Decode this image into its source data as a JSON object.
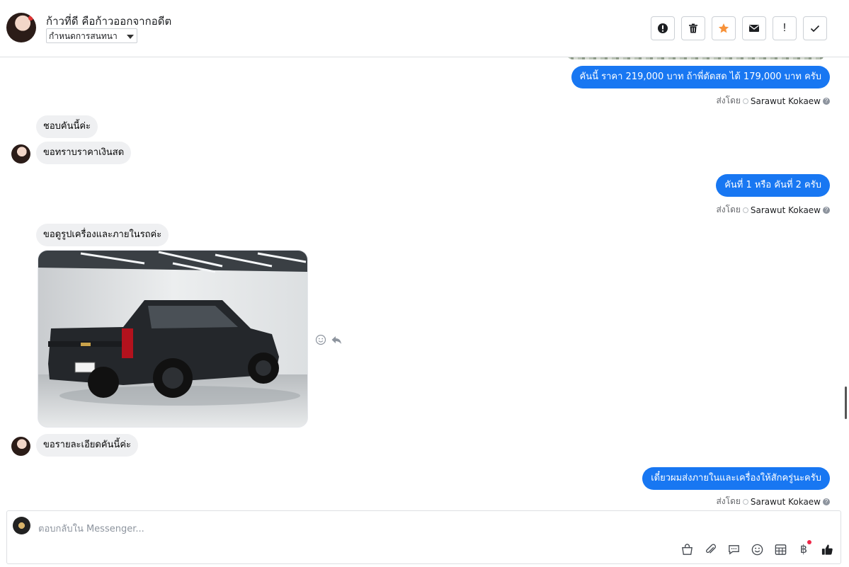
{
  "header": {
    "title": "ก้าวที่ดี คือก้าวออกจากอดีต",
    "assign_label": "กำหนดการสนทนา",
    "actions": [
      {
        "name": "spam-alert-button",
        "icon": "alert-circle-icon"
      },
      {
        "name": "delete-button",
        "icon": "trash-icon"
      },
      {
        "name": "star-button",
        "icon": "star-icon",
        "color": "#f7923a"
      },
      {
        "name": "mark-unread-button",
        "icon": "envelope-icon"
      },
      {
        "name": "follow-up-button",
        "icon": "exclamation-icon",
        "text": "!"
      },
      {
        "name": "mark-done-button",
        "icon": "check-icon"
      }
    ]
  },
  "messages": {
    "out1": "คันนี้  ราคา 219,000 บาท  ถ้าพี่ตัดสด ได้ 179,000 บาท ครับ",
    "in1": "ชอบคันนี้ค่ะ",
    "in2": "ขอทราบราคาเงินสด",
    "out2": "คันที่ 1 หรือ คันที่ 2 ครับ",
    "in3": "ขอดูรูปเครื่องและภายในรถค่ะ",
    "in4": "ขอรายละเอียดคันนี้ค่ะ",
    "out3": "เดี๋ยวผมส่งภายในและเครื่องให้สักครู่นะครับ"
  },
  "sent_by": {
    "prefix": "ส่งโดย",
    "name": "Sarawut Kokaew",
    "help": "?"
  },
  "composer": {
    "placeholder": "ตอบกลับใน Messenger...",
    "baht_symbol": "฿",
    "tools": [
      "shop-icon",
      "attachment-icon",
      "saved-reply-icon",
      "emoji-icon",
      "table-icon",
      "baht-icon",
      "thumbs-up-icon"
    ]
  },
  "colors": {
    "outgoing_bubble": "#1877f2",
    "incoming_bubble": "#eff0f2",
    "star": "#f7923a",
    "notification_dot": "#f02849"
  }
}
